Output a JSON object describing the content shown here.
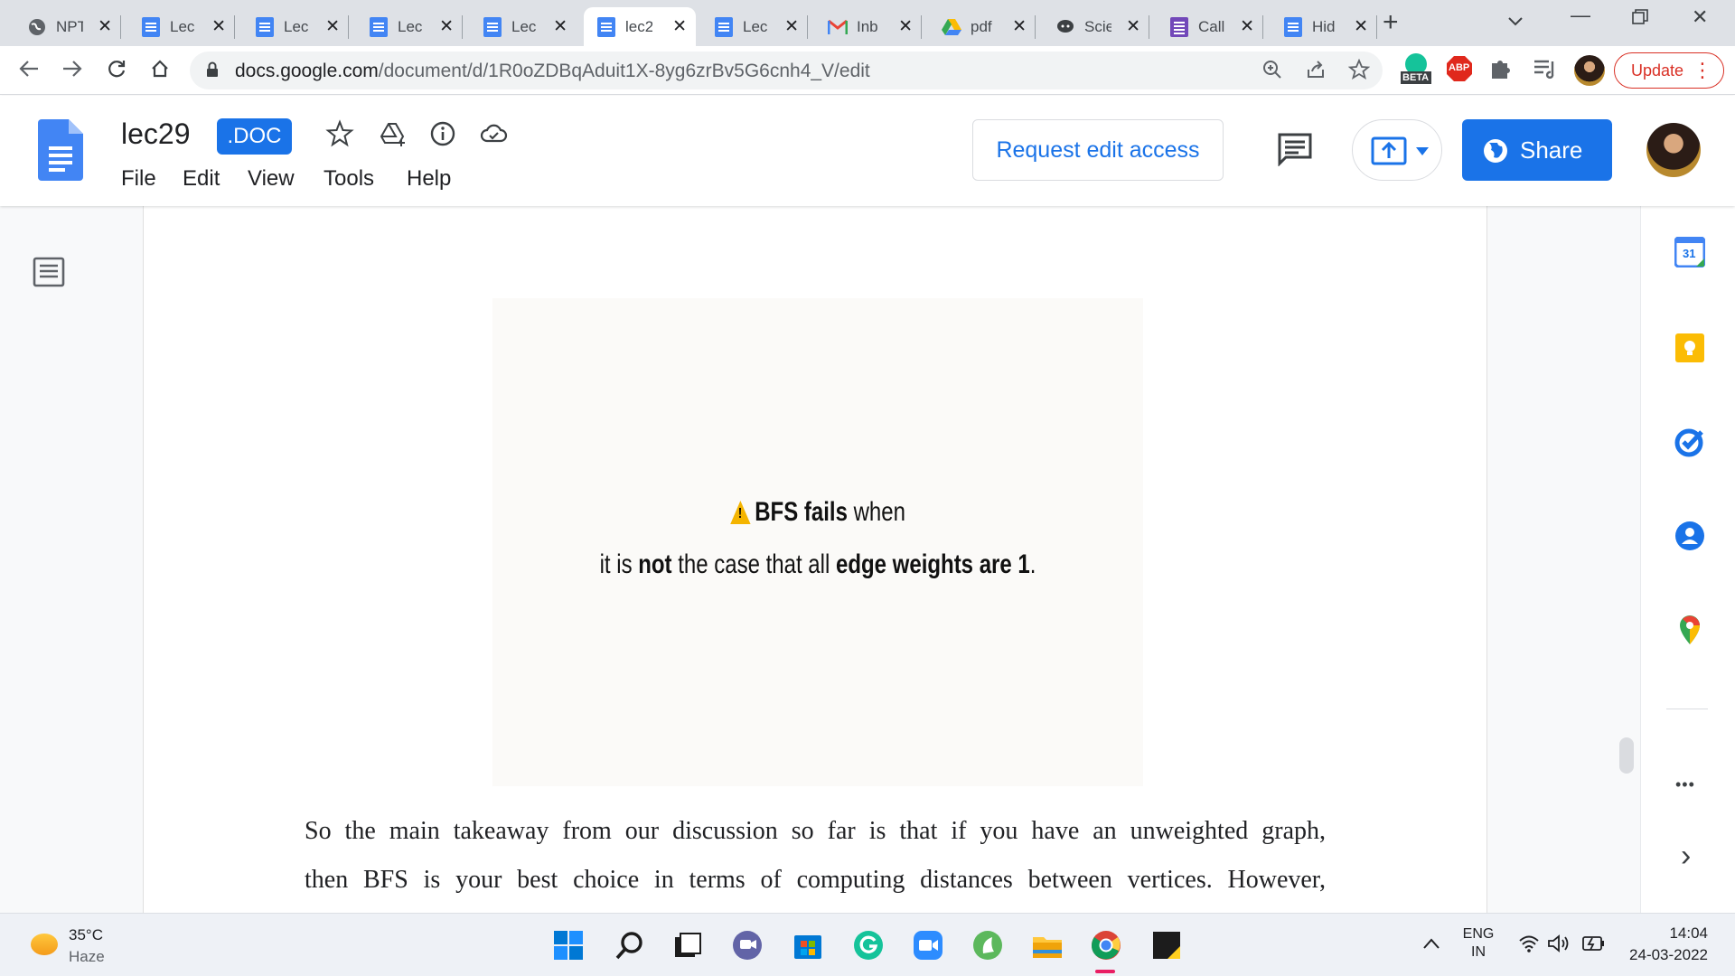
{
  "browser": {
    "tabs": [
      {
        "title": "NPT",
        "favicon": "globe-icon"
      },
      {
        "title": "Lec",
        "favicon": "docs-icon"
      },
      {
        "title": "Lec",
        "favicon": "docs-icon"
      },
      {
        "title": "Lec",
        "favicon": "docs-icon"
      },
      {
        "title": "Lec",
        "favicon": "docs-icon"
      },
      {
        "title": "lec2",
        "favicon": "docs-icon",
        "active": true
      },
      {
        "title": "Lec",
        "favicon": "docs-icon"
      },
      {
        "title": "Inb",
        "favicon": "gmail-icon"
      },
      {
        "title": "pdf",
        "favicon": "drive-icon"
      },
      {
        "title": "Scie",
        "favicon": "chat-icon"
      },
      {
        "title": "Call",
        "favicon": "forms-icon"
      },
      {
        "title": "Hid",
        "favicon": "docs-icon"
      }
    ],
    "new_tab": "+",
    "url_host": "docs.google.com",
    "url_path": "/document/d/1R0oZDBqAduit1X-8yg6zrBv5G6cnh4_V/edit",
    "ext_beta_label": "BETA",
    "ext_abp_label": "ABP",
    "update_label": "Update"
  },
  "docs": {
    "title": "lec29",
    "badge": ".DOC",
    "menu": [
      "File",
      "Edit",
      "View",
      "Tools",
      "Help"
    ],
    "request_edit_label": "Request edit access",
    "share_label": "Share"
  },
  "document": {
    "figure_line1_bold": "BFS fails",
    "figure_line1_rest": " when",
    "figure_line2_a": "it is ",
    "figure_line2_b": "not",
    "figure_line2_c": " the case that all ",
    "figure_line2_d": "edge weights are 1",
    "figure_line2_e": ".",
    "para_line1": "So the main takeaway from our discussion so far is that if you have an unweighted graph,",
    "para_line2": "then BFS is your best choice in terms of computing distances between vertices. However,"
  },
  "side_panel": {
    "calendar_day": "31",
    "more": "•••",
    "expand": "›"
  },
  "taskbar": {
    "temperature": "35°C",
    "weather": "Haze",
    "lang_top": "ENG",
    "lang_bottom": "IN",
    "time": "14:04",
    "date": "24-03-2022"
  },
  "colors": {
    "accent": "#1a73e8",
    "update_red": "#d93025",
    "warning": "#f4b400"
  }
}
